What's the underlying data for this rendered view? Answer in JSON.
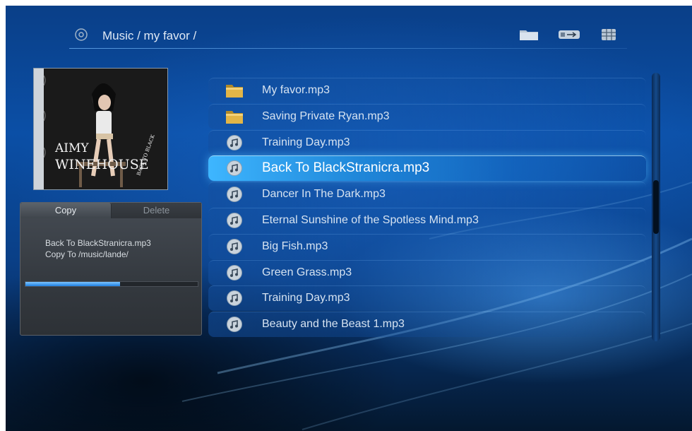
{
  "header": {
    "breadcrumb": "Music / my favor /",
    "icons": [
      "disc-icon",
      "folder-icon",
      "usb-icon",
      "grid-view-icon"
    ]
  },
  "album_art": {
    "artist_text": "AMY WINEHOUSE",
    "title_text": "BACK TO BLACK"
  },
  "copy_panel": {
    "tabs": [
      {
        "label": "Copy",
        "active": true
      },
      {
        "label": "Delete",
        "active": false
      }
    ],
    "file_line": "Back To BlackStranicra.mp3",
    "dest_line": "Copy To  /music/lande/",
    "progress": 0.55
  },
  "file_list": {
    "items": [
      {
        "label": "My favor.mp3",
        "icon": "folder-icon",
        "selected": false
      },
      {
        "label": "Saving Private Ryan.mp3",
        "icon": "folder-icon",
        "selected": false
      },
      {
        "label": "Training Day.mp3",
        "icon": "music-note-icon",
        "selected": false
      },
      {
        "label": "Back To BlackStranicra.mp3",
        "icon": "music-note-icon",
        "selected": true
      },
      {
        "label": "Dancer In The Dark.mp3",
        "icon": "music-note-icon",
        "selected": false
      },
      {
        "label": "Eternal Sunshine of the Spotless Mind.mp3",
        "icon": "music-note-icon",
        "selected": false
      },
      {
        "label": "Big Fish.mp3",
        "icon": "music-note-icon",
        "selected": false
      },
      {
        "label": "Green Grass.mp3",
        "icon": "music-note-icon",
        "selected": false
      },
      {
        "label": "Training Day.mp3",
        "icon": "music-note-icon",
        "selected": false
      },
      {
        "label": "Beauty and the Beast 1.mp3",
        "icon": "music-note-icon",
        "selected": false
      }
    ]
  },
  "scrollbar": {
    "position": 0.4
  }
}
